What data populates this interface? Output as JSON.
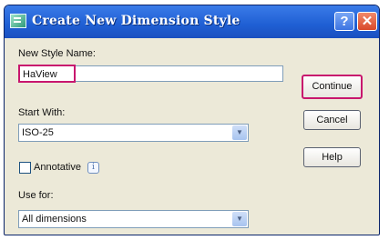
{
  "window": {
    "title": "Create New Dimension Style",
    "help_glyph": "?",
    "close_glyph": "✕"
  },
  "form": {
    "new_style_name_label": "New Style Name:",
    "new_style_name_value": "HaView",
    "start_with_label": "Start With:",
    "start_with_value": "ISO-25",
    "annotative_label": "Annotative",
    "annotative_checked": false,
    "info_glyph": "i",
    "use_for_label": "Use for:",
    "use_for_value": "All dimensions",
    "dropdown_glyph": "▼"
  },
  "buttons": {
    "continue": "Continue",
    "cancel": "Cancel",
    "help": "Help"
  },
  "colors": {
    "highlight": "#c8166e",
    "titlebar": "#1f5fd3"
  },
  "icons": {
    "app": "dimension-style-icon",
    "help": "help-icon",
    "close": "close-icon",
    "info": "info-icon",
    "dropdown": "chevron-down-icon"
  }
}
